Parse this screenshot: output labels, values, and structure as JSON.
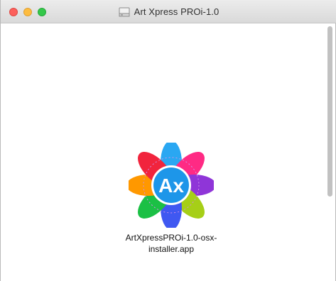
{
  "window": {
    "title": "Art Xpress PROi-1.0",
    "title_icon": "disk-image-icon"
  },
  "traffic_lights": {
    "close": "#fc605c",
    "minimize": "#fdbc40",
    "zoom": "#34c84a"
  },
  "app": {
    "icon_text": "Ax",
    "icon_name": "art-xpress-flower-icon",
    "label": "ArtXpressPROi-1.0-osx-\ninstaller.app"
  },
  "scrollbar": {
    "visible": true
  }
}
